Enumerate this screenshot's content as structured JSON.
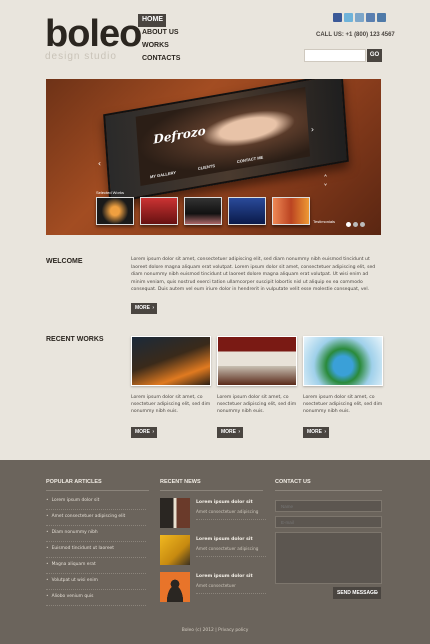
{
  "header": {
    "logo_title": "boleo",
    "logo_subtitle": "design studio",
    "nav": [
      {
        "label": "HOME",
        "active": true
      },
      {
        "label": "ABOUT US",
        "active": false
      },
      {
        "label": "WORKS",
        "active": false
      },
      {
        "label": "CONTACTS",
        "active": false
      }
    ],
    "social_icons": [
      "facebook-icon",
      "twitter-icon",
      "rss-icon",
      "delicious-icon",
      "myspace-icon"
    ],
    "call": "CALL US: +1 (800) 123 4567",
    "search_placeholder": "",
    "search_button": "GO"
  },
  "slider": {
    "brand": "Defrozo",
    "tabs": [
      "MY GALLERY",
      "CLIENTS",
      "CONTACT ME"
    ],
    "label_selected": "Selected Works",
    "label_testimonials": "Testimonials"
  },
  "welcome": {
    "title": "WELCOME",
    "text": "Lorem ipsum dolor sit amet, consectetuer adipiscing elit, sed diam nonummy nibh euismod tincidunt ut laoreet dolore magna aliquam erat volutpat. Lorem ipsum dolor sit amet, consectetuer adipiscing elit, sed diam nonummy nibh euismod tincidunt ut laoreet dolore magna aliquam erat volutpat. Ut wisi enim ad minim veniam, quis nostrud exerci tation ullamcorper suscipit lobortis nisl ut aliquip ex ea commodo consequat. Duis autem vel eum iriure dolor in hendrerit in vulputate velit esse molestie consequat, vel.",
    "more": "MORE"
  },
  "recent_works": {
    "title": "RECENT WORKS",
    "items": [
      {
        "text": "Lorem ipsum dolor sit amet, co nsectetuer adipiscing elit, sed dim nonummy nibh euis.",
        "more": "MORE"
      },
      {
        "text": "Lorem ipsum dolor sit amet, co nsectetuer adipiscing elit, sed dim nonummy nibh euis.",
        "more": "MORE"
      },
      {
        "text": "Lorem ipsum dolor sit amet, co nsectetuer adipiscing elit, sed dim nonummy nibh euis.",
        "more": "MORE"
      }
    ]
  },
  "footer": {
    "popular_title": "POPULAR ARTICLES",
    "articles": [
      "Lorem ipsum dolor sit",
      "Amet consectetuer adipiscing elit",
      "Diam nonummy nibh",
      "Euismod tincidunt ut laoreet",
      "Magna aliquam erat",
      "Volutpat ut wisi enim",
      "Aliobo venium quis"
    ],
    "news_title": "RECENT NEWS",
    "news": [
      {
        "title": "Lorem ipsum dolor sit",
        "sub": "Amet consectetuer adipiscing"
      },
      {
        "title": "Lorem ipsum dolor sit",
        "sub": "Amet consectetuer adipiscing"
      },
      {
        "title": "Lorem ipsum dolor sit",
        "sub": "Amet consectetuer"
      }
    ],
    "contact_title": "CONTACT US",
    "name_placeholder": "Name",
    "email_placeholder": "E-mail",
    "message_placeholder": "",
    "send_label": "SEND MESSAGE",
    "copyright": "Boleo (c) 2012  |  Privacy policy"
  }
}
